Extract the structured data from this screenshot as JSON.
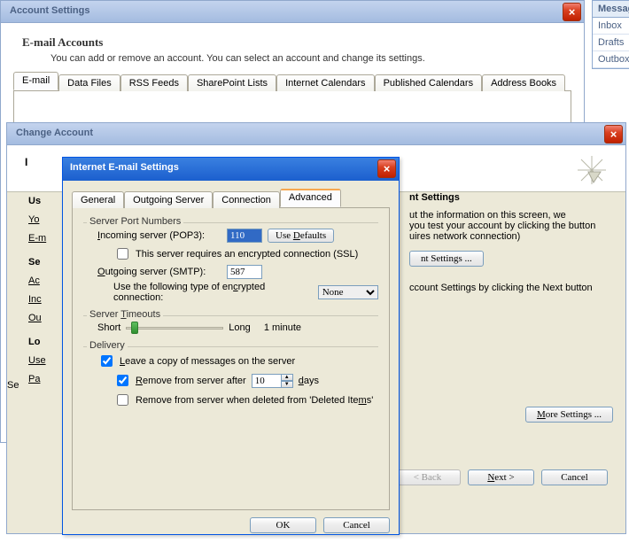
{
  "messages_panel": {
    "header": "Messages",
    "items": [
      "Inbox",
      "Drafts",
      "Outbox"
    ]
  },
  "account_settings": {
    "title": "Account Settings",
    "section_heading": "E-mail Accounts",
    "section_desc": "You can add or remove an account. You can select an account and change its settings.",
    "tabs": [
      "E-mail",
      "Data Files",
      "RSS Feeds",
      "SharePoint Lists",
      "Internet Calendars",
      "Published Calendars",
      "Address Books"
    ],
    "active_tab_index": 0
  },
  "change_account": {
    "title": "Change Account",
    "header_bold_prefix": "I",
    "left_labels": {
      "us": "Us",
      "yo": "Yo",
      "em": "E-m",
      "se": "Se",
      "ac": "Ac",
      "inc": "Inc",
      "ou": "Ou",
      "lo": "Lo",
      "use": "Use",
      "pa": "Pa"
    },
    "searching": "Se",
    "right": {
      "heading_suffix": "nt Settings",
      "para1a": "ut the information on this screen, we",
      "para1b": "you test your account by clicking the button",
      "para1c": "uires network connection)",
      "test_btn": "nt Settings ...",
      "para2": "ccount Settings by clicking the Next button",
      "more_btn": "More Settings ..."
    },
    "footer": {
      "back": "< Back",
      "next": "Next >",
      "cancel": "Cancel"
    }
  },
  "email_settings": {
    "title": "Internet E-mail Settings",
    "tabs": [
      "General",
      "Outgoing Server",
      "Connection",
      "Advanced"
    ],
    "active_tab_index": 3,
    "grp_ports": "Server Port Numbers",
    "incoming_label": "Incoming server (POP3):",
    "incoming_value": "110",
    "use_defaults": "Use Defaults",
    "ssl_label": "This server requires an encrypted connection (SSL)",
    "ssl_checked": false,
    "outgoing_label": "Outgoing server (SMTP):",
    "outgoing_value": "587",
    "enc_label": "Use the following type of encrypted connection:",
    "enc_value": "None",
    "grp_timeouts": "Server Timeouts",
    "short": "Short",
    "long": "Long",
    "timeout_value": "1 minute",
    "grp_delivery": "Delivery",
    "leave_copy": "Leave a copy of messages on the server",
    "leave_copy_checked": true,
    "remove_after": "Remove from server after",
    "remove_after_checked": true,
    "remove_days_value": "10",
    "days": "days",
    "remove_deleted": "Remove from server when deleted from 'Deleted Items'",
    "remove_deleted_checked": false,
    "ok": "OK",
    "cancel": "Cancel"
  }
}
